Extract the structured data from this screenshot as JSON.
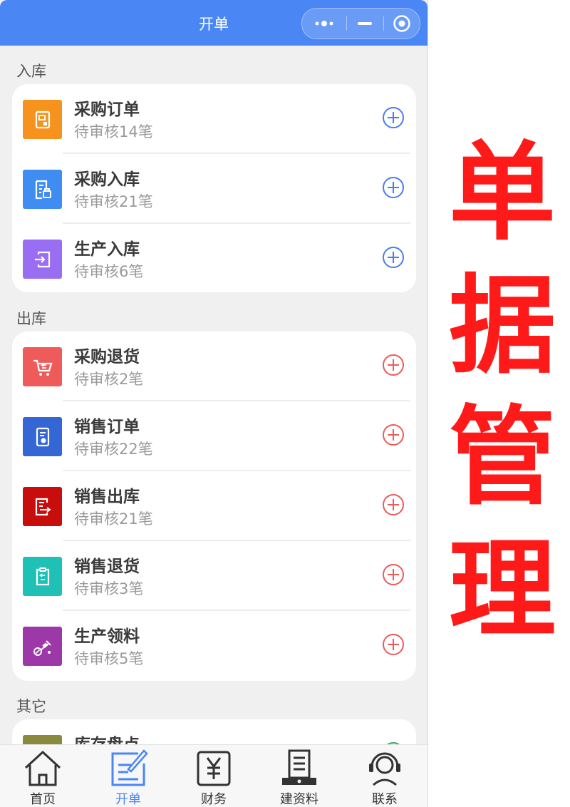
{
  "navbar": {
    "title": "开单"
  },
  "sections": {
    "inbound": {
      "title": "入库",
      "items": [
        {
          "title": "采购订单",
          "sub": "待审核14笔",
          "icon": "purchase-order-icon",
          "color": "#f6931e"
        },
        {
          "title": "采购入库",
          "sub": "待审核21笔",
          "icon": "purchase-inbound-icon",
          "color": "#3f8cf3"
        },
        {
          "title": "生产入库",
          "sub": "待审核6笔",
          "icon": "production-inbound-icon",
          "color": "#9a6ef2"
        }
      ]
    },
    "outbound": {
      "title": "出库",
      "items": [
        {
          "title": "采购退货",
          "sub": "待审核2笔",
          "icon": "purchase-return-icon",
          "color": "#ef5b5b"
        },
        {
          "title": "销售订单",
          "sub": "待审核22笔",
          "icon": "sales-order-icon",
          "color": "#3566d6"
        },
        {
          "title": "销售出库",
          "sub": "待审核21笔",
          "icon": "sales-outbound-icon",
          "color": "#c80d0d"
        },
        {
          "title": "销售退货",
          "sub": "待审核3笔",
          "icon": "sales-return-icon",
          "color": "#1fc1b6"
        },
        {
          "title": "生产领料",
          "sub": "待审核5笔",
          "icon": "production-material-icon",
          "color": "#9c38a8"
        }
      ]
    },
    "other": {
      "title": "其它",
      "items": [
        {
          "title": "库存盘点",
          "icon": "stocktake-icon",
          "color": "#8a8a3c"
        }
      ]
    }
  },
  "tabbar": {
    "tabs": [
      {
        "label": "首页",
        "icon": "home-icon"
      },
      {
        "label": "开单",
        "icon": "create-order-icon",
        "active": true
      },
      {
        "label": "财务",
        "icon": "finance-icon"
      },
      {
        "label": "建资料",
        "icon": "build-data-icon"
      },
      {
        "label": "联系",
        "icon": "contact-icon"
      }
    ]
  },
  "side_caption": {
    "chars": [
      "单",
      "据",
      "管",
      "理"
    ]
  },
  "colors": {
    "primary": "#4a87f5",
    "add_blue": "#4a7cf0",
    "add_red": "#ee5a5a",
    "caption_red": "#ff1a1a"
  }
}
